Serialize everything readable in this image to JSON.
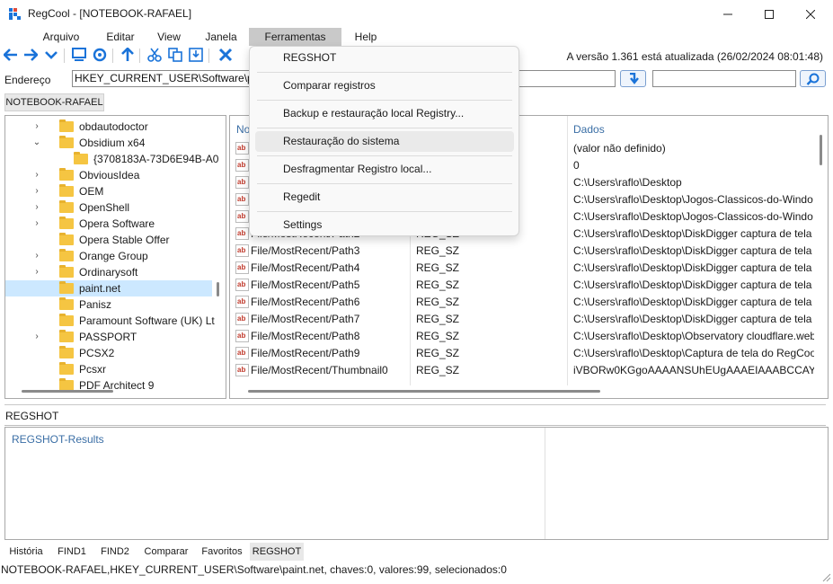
{
  "window": {
    "title": "RegCool - [NOTEBOOK-RAFAEL]",
    "minimize_icon": "minimize-icon",
    "maximize_icon": "maximize-icon",
    "close_icon": "close-icon"
  },
  "menu": [
    "Arquivo",
    "Editar",
    "View",
    "Janela",
    "Ferramentas",
    "Help"
  ],
  "toolbar": {
    "icons": [
      "back-arrow-icon",
      "forward-arrow-icon",
      "chevron-down-icon",
      "computer-icon",
      "network-icon",
      "up-arrow-icon",
      "cut-icon",
      "copy-icon",
      "save-icon",
      "delete-icon"
    ],
    "version_text": "A versão 1.361 está atualizada (26/02/2024 08:01:48)"
  },
  "address": {
    "label": "Endereço",
    "value": "HKEY_CURRENT_USER\\Software\\paint.net",
    "search_value": ""
  },
  "computer_tab": "NOTEBOOK-RAFAEL",
  "tree": {
    "rows": [
      {
        "label": "obdautodoctor",
        "chev": "›"
      },
      {
        "label": "Obsidium x64",
        "chev": "⌄"
      },
      {
        "label": "{3708183A-73D6E94B-A0",
        "chev": ""
      },
      {
        "label": "ObviousIdea",
        "chev": "›"
      },
      {
        "label": "OEM",
        "chev": "›"
      },
      {
        "label": "OpenShell",
        "chev": "›"
      },
      {
        "label": "Opera Software",
        "chev": "›"
      },
      {
        "label": "Opera Stable Offer",
        "chev": ""
      },
      {
        "label": "Orange Group",
        "chev": "›"
      },
      {
        "label": "Ordinarysoft",
        "chev": "›"
      },
      {
        "label": "paint.net",
        "chev": ""
      },
      {
        "label": "Panisz",
        "chev": ""
      },
      {
        "label": "Paramount Software (UK) Lt",
        "chev": ""
      },
      {
        "label": "PASSPORT",
        "chev": "›"
      },
      {
        "label": "PCSX2",
        "chev": ""
      },
      {
        "label": "Pcsxr",
        "chev": ""
      },
      {
        "label": "PDF Architect 9",
        "chev": ""
      }
    ]
  },
  "list": {
    "headers": [
      "No",
      "",
      "Dados"
    ],
    "rows": [
      {
        "name": "",
        "type": "",
        "data": "(valor não definido)"
      },
      {
        "name": "",
        "type": "",
        "data": "0"
      },
      {
        "name": "",
        "type": "",
        "data": "C:\\Users\\raflo\\Desktop"
      },
      {
        "name": "",
        "type": "",
        "data": "C:\\Users\\raflo\\Desktop\\Jogos-Classicos-do-Windo"
      },
      {
        "name": "",
        "type": "",
        "data": "C:\\Users\\raflo\\Desktop\\Jogos-Classicos-do-Windo"
      },
      {
        "name": "File/MostRecent/Path2",
        "type": "REG_SZ",
        "data": "C:\\Users\\raflo\\Desktop\\DiskDigger captura de tela"
      },
      {
        "name": "File/MostRecent/Path3",
        "type": "REG_SZ",
        "data": "C:\\Users\\raflo\\Desktop\\DiskDigger captura de tela"
      },
      {
        "name": "File/MostRecent/Path4",
        "type": "REG_SZ",
        "data": "C:\\Users\\raflo\\Desktop\\DiskDigger captura de tela"
      },
      {
        "name": "File/MostRecent/Path5",
        "type": "REG_SZ",
        "data": "C:\\Users\\raflo\\Desktop\\DiskDigger captura de tela"
      },
      {
        "name": "File/MostRecent/Path6",
        "type": "REG_SZ",
        "data": "C:\\Users\\raflo\\Desktop\\DiskDigger captura de tela"
      },
      {
        "name": "File/MostRecent/Path7",
        "type": "REG_SZ",
        "data": "C:\\Users\\raflo\\Desktop\\DiskDigger captura de tela"
      },
      {
        "name": "File/MostRecent/Path8",
        "type": "REG_SZ",
        "data": "C:\\Users\\raflo\\Desktop\\Observatory cloudflare.web"
      },
      {
        "name": "File/MostRecent/Path9",
        "type": "REG_SZ",
        "data": "C:\\Users\\raflo\\Desktop\\Captura de tela do RegCoo"
      },
      {
        "name": "File/MostRecent/Thumbnail0",
        "type": "REG_SZ",
        "data": "iVBORw0KGgoAAAANSUhEUgAAAEIAAABCCAYAA"
      }
    ],
    "value_icon_text": "ab"
  },
  "dropdown": {
    "items": [
      "REGSHOT",
      "Comparar registros",
      "Backup e restauração local Registry...",
      "Restauração do sistema",
      "Desfragmentar Registro local...",
      "Regedit",
      "Settings"
    ],
    "hovered": "Restauração do sistema"
  },
  "regshot": {
    "label": "REGSHOT",
    "results_title": "REGSHOT-Results"
  },
  "bottom_tabs": [
    "História",
    "FIND1",
    "FIND2",
    "Comparar",
    "Favoritos",
    "REGSHOT"
  ],
  "status": "NOTEBOOK-RAFAEL,HKEY_CURRENT_USER\\Software\\paint.net, chaves:0, valores:99, selecionados:0",
  "colors": {
    "accent": "#1a73d9",
    "folder": "#f5c542",
    "selection": "#cce8ff",
    "menu_active": "#c9c9c9"
  }
}
